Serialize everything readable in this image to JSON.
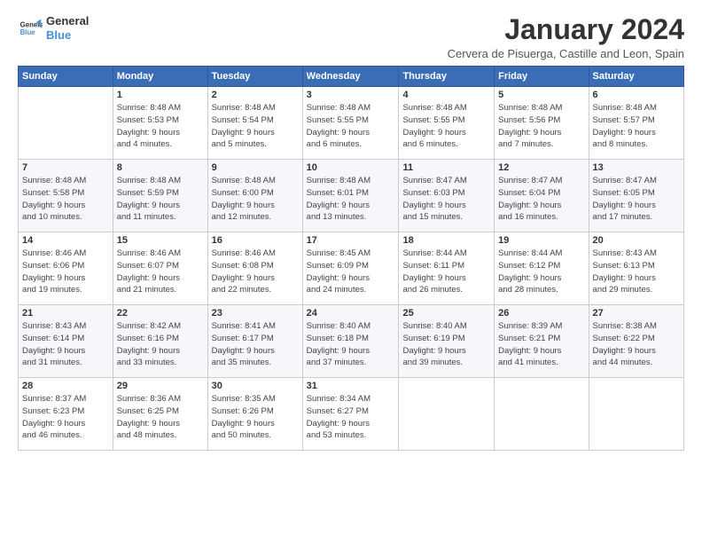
{
  "logo": {
    "line1": "General",
    "line2": "Blue"
  },
  "title": "January 2024",
  "subtitle": "Cervera de Pisuerga, Castille and Leon, Spain",
  "weekdays": [
    "Sunday",
    "Monday",
    "Tuesday",
    "Wednesday",
    "Thursday",
    "Friday",
    "Saturday"
  ],
  "weeks": [
    [
      {
        "day": "",
        "info": ""
      },
      {
        "day": "1",
        "info": "Sunrise: 8:48 AM\nSunset: 5:53 PM\nDaylight: 9 hours\nand 4 minutes."
      },
      {
        "day": "2",
        "info": "Sunrise: 8:48 AM\nSunset: 5:54 PM\nDaylight: 9 hours\nand 5 minutes."
      },
      {
        "day": "3",
        "info": "Sunrise: 8:48 AM\nSunset: 5:55 PM\nDaylight: 9 hours\nand 6 minutes."
      },
      {
        "day": "4",
        "info": "Sunrise: 8:48 AM\nSunset: 5:55 PM\nDaylight: 9 hours\nand 6 minutes."
      },
      {
        "day": "5",
        "info": "Sunrise: 8:48 AM\nSunset: 5:56 PM\nDaylight: 9 hours\nand 7 minutes."
      },
      {
        "day": "6",
        "info": "Sunrise: 8:48 AM\nSunset: 5:57 PM\nDaylight: 9 hours\nand 8 minutes."
      }
    ],
    [
      {
        "day": "7",
        "info": "Sunrise: 8:48 AM\nSunset: 5:58 PM\nDaylight: 9 hours\nand 10 minutes."
      },
      {
        "day": "8",
        "info": "Sunrise: 8:48 AM\nSunset: 5:59 PM\nDaylight: 9 hours\nand 11 minutes."
      },
      {
        "day": "9",
        "info": "Sunrise: 8:48 AM\nSunset: 6:00 PM\nDaylight: 9 hours\nand 12 minutes."
      },
      {
        "day": "10",
        "info": "Sunrise: 8:48 AM\nSunset: 6:01 PM\nDaylight: 9 hours\nand 13 minutes."
      },
      {
        "day": "11",
        "info": "Sunrise: 8:47 AM\nSunset: 6:03 PM\nDaylight: 9 hours\nand 15 minutes."
      },
      {
        "day": "12",
        "info": "Sunrise: 8:47 AM\nSunset: 6:04 PM\nDaylight: 9 hours\nand 16 minutes."
      },
      {
        "day": "13",
        "info": "Sunrise: 8:47 AM\nSunset: 6:05 PM\nDaylight: 9 hours\nand 17 minutes."
      }
    ],
    [
      {
        "day": "14",
        "info": "Sunrise: 8:46 AM\nSunset: 6:06 PM\nDaylight: 9 hours\nand 19 minutes."
      },
      {
        "day": "15",
        "info": "Sunrise: 8:46 AM\nSunset: 6:07 PM\nDaylight: 9 hours\nand 21 minutes."
      },
      {
        "day": "16",
        "info": "Sunrise: 8:46 AM\nSunset: 6:08 PM\nDaylight: 9 hours\nand 22 minutes."
      },
      {
        "day": "17",
        "info": "Sunrise: 8:45 AM\nSunset: 6:09 PM\nDaylight: 9 hours\nand 24 minutes."
      },
      {
        "day": "18",
        "info": "Sunrise: 8:44 AM\nSunset: 6:11 PM\nDaylight: 9 hours\nand 26 minutes."
      },
      {
        "day": "19",
        "info": "Sunrise: 8:44 AM\nSunset: 6:12 PM\nDaylight: 9 hours\nand 28 minutes."
      },
      {
        "day": "20",
        "info": "Sunrise: 8:43 AM\nSunset: 6:13 PM\nDaylight: 9 hours\nand 29 minutes."
      }
    ],
    [
      {
        "day": "21",
        "info": "Sunrise: 8:43 AM\nSunset: 6:14 PM\nDaylight: 9 hours\nand 31 minutes."
      },
      {
        "day": "22",
        "info": "Sunrise: 8:42 AM\nSunset: 6:16 PM\nDaylight: 9 hours\nand 33 minutes."
      },
      {
        "day": "23",
        "info": "Sunrise: 8:41 AM\nSunset: 6:17 PM\nDaylight: 9 hours\nand 35 minutes."
      },
      {
        "day": "24",
        "info": "Sunrise: 8:40 AM\nSunset: 6:18 PM\nDaylight: 9 hours\nand 37 minutes."
      },
      {
        "day": "25",
        "info": "Sunrise: 8:40 AM\nSunset: 6:19 PM\nDaylight: 9 hours\nand 39 minutes."
      },
      {
        "day": "26",
        "info": "Sunrise: 8:39 AM\nSunset: 6:21 PM\nDaylight: 9 hours\nand 41 minutes."
      },
      {
        "day": "27",
        "info": "Sunrise: 8:38 AM\nSunset: 6:22 PM\nDaylight: 9 hours\nand 44 minutes."
      }
    ],
    [
      {
        "day": "28",
        "info": "Sunrise: 8:37 AM\nSunset: 6:23 PM\nDaylight: 9 hours\nand 46 minutes."
      },
      {
        "day": "29",
        "info": "Sunrise: 8:36 AM\nSunset: 6:25 PM\nDaylight: 9 hours\nand 48 minutes."
      },
      {
        "day": "30",
        "info": "Sunrise: 8:35 AM\nSunset: 6:26 PM\nDaylight: 9 hours\nand 50 minutes."
      },
      {
        "day": "31",
        "info": "Sunrise: 8:34 AM\nSunset: 6:27 PM\nDaylight: 9 hours\nand 53 minutes."
      },
      {
        "day": "",
        "info": ""
      },
      {
        "day": "",
        "info": ""
      },
      {
        "day": "",
        "info": ""
      }
    ]
  ]
}
